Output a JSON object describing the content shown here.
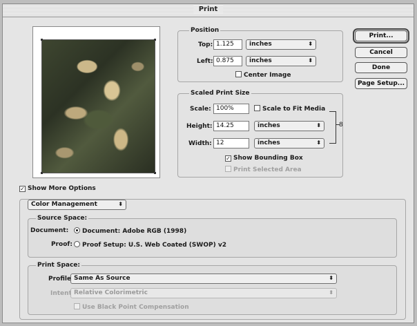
{
  "window": {
    "title": "Print"
  },
  "position": {
    "group_title": "Position",
    "top_label": "Top:",
    "top_value": "1.125",
    "top_unit": "inches",
    "left_label": "Left:",
    "left_value": "0.875",
    "left_unit": "inches",
    "center_image_label": "Center Image"
  },
  "scaled": {
    "group_title": "Scaled Print Size",
    "scale_label": "Scale:",
    "scale_value": "100%",
    "scale_to_fit_label": "Scale to Fit Media",
    "height_label": "Height:",
    "height_value": "14.25",
    "height_unit": "inches",
    "width_label": "Width:",
    "width_value": "12",
    "width_unit": "inches",
    "show_bounding_box_label": "Show Bounding Box",
    "show_bounding_box_checked": "✓",
    "print_selected_area_label": "Print Selected Area"
  },
  "buttons": {
    "print": "Print...",
    "cancel": "Cancel",
    "done": "Done",
    "page_setup": "Page Setup..."
  },
  "more_options": {
    "label": "Show More Options",
    "checked": "✓",
    "section_popup": "Color Management"
  },
  "source_space": {
    "title": "Source Space:",
    "document_label": "Document:",
    "document_option": "Document: Adobe RGB (1998)",
    "proof_label": "Proof:",
    "proof_option": "Proof Setup: U.S. Web Coated (SWOP) v2"
  },
  "print_space": {
    "title": "Print Space:",
    "profile_label": "Profile:",
    "profile_value": "Same As Source",
    "intent_label": "Intent:",
    "intent_value": "Relative Colorimetric",
    "black_point_label": "Use Black Point Compensation"
  },
  "icons": {
    "popup_arrow": "⬍",
    "check": "✓",
    "link": "8"
  }
}
